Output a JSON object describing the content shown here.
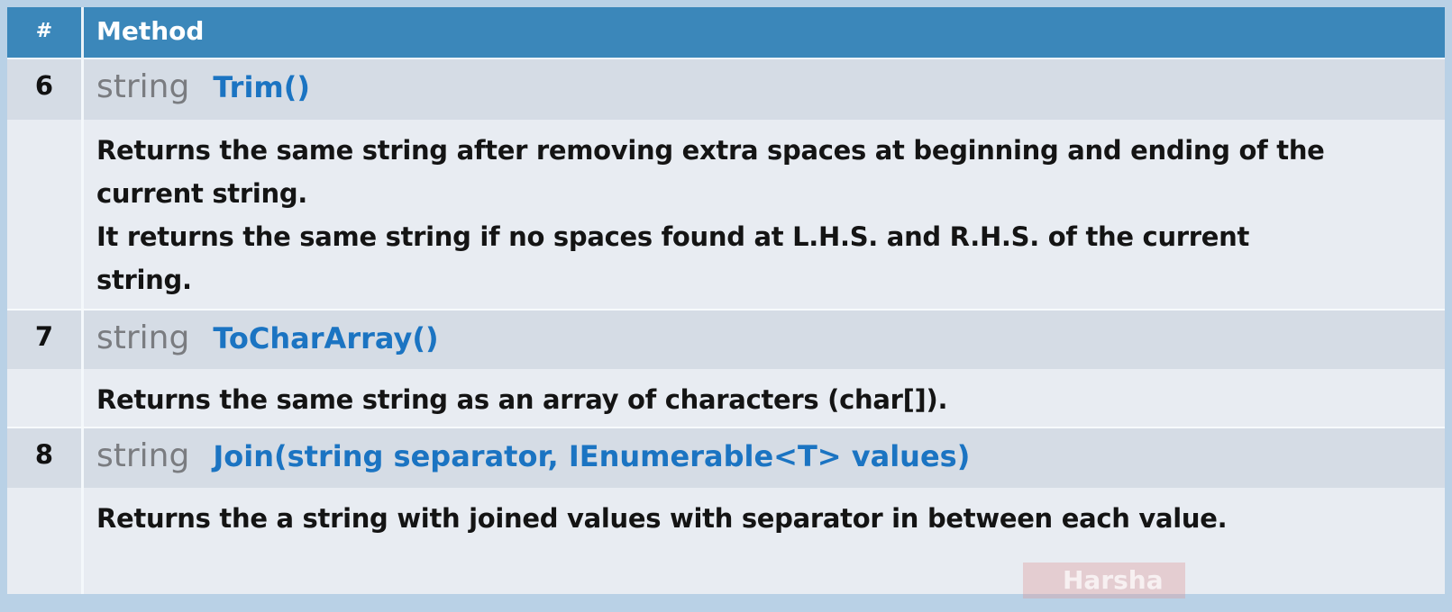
{
  "header": {
    "num_label": "#",
    "method_label": "Method"
  },
  "rows": [
    {
      "num": "6",
      "return_type": "string",
      "signature": "Trim()",
      "description": [
        "Returns the same string after removing extra spaces at beginning and ending of the current string.",
        "It returns the same string if no spaces found at L.H.S. and R.H.S. of the current string."
      ]
    },
    {
      "num": "7",
      "return_type": "string",
      "signature": "ToCharArray()",
      "description": [
        "Returns the same string as an array of characters (char[])."
      ]
    },
    {
      "num": "8",
      "return_type": "string",
      "signature": "Join(string  separator, IEnumerable<T>  values)",
      "description": [
        "Returns the a string with joined values with separator in between each value."
      ]
    }
  ],
  "watermark": "Harsha"
}
